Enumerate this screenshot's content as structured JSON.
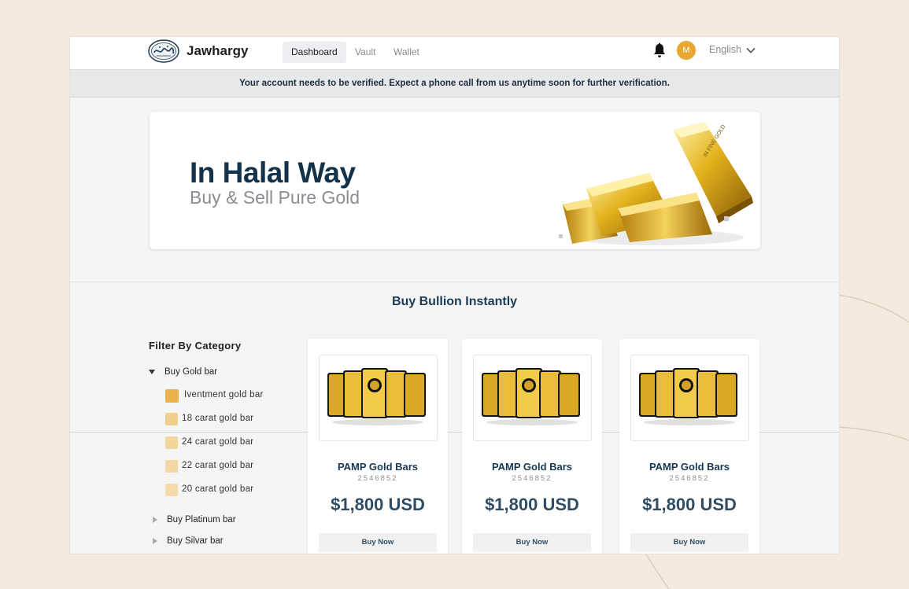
{
  "header": {
    "brand": "Jawhargy",
    "tabs": [
      {
        "label": "Dashboard",
        "active": true
      },
      {
        "label": "Vault",
        "active": false
      },
      {
        "label": "Wallet",
        "active": false
      }
    ],
    "icons": {
      "notifications": "bell-icon",
      "language_toggle": "chevron-down-icon"
    },
    "avatar_initial": "M",
    "language": "English"
  },
  "notice": "Your account needs to be verified. Expect a phone call from us anytime soon for further verification.",
  "hero": {
    "title": "In Halal Way",
    "subtitle": "Buy & Sell Pure Gold"
  },
  "section_title": "Buy Bullion Instantly",
  "filter": {
    "title": "Filter By Category",
    "categories": [
      {
        "label": "Buy Gold bar",
        "expanded": true,
        "subcategories": [
          {
            "label": "Iventment gold bar",
            "color": "#e8b34b"
          },
          {
            "label": "18 carat gold bar",
            "color": "#f0cf8c"
          },
          {
            "label": "24 carat gold bar",
            "color": "#f2d69b"
          },
          {
            "label": "22 carat gold bar",
            "color": "#f2d9a3"
          },
          {
            "label": "20 carat gold bar",
            "color": "#f3dbaa"
          }
        ]
      },
      {
        "label": "Buy Platinum bar",
        "expanded": false
      },
      {
        "label": "Buy Silvar bar",
        "expanded": false
      }
    ]
  },
  "products": [
    {
      "name": "PAMP Gold Bars",
      "sku": "2546852",
      "price": "$1,800 USD",
      "button": "Buy Now"
    },
    {
      "name": "PAMP Gold Bars",
      "sku": "2546852",
      "price": "$1,800 USD",
      "button": "Buy Now"
    },
    {
      "name": "PAMP Gold Bars",
      "sku": "2546852",
      "price": "$1,800 USD",
      "button": "Buy Now"
    }
  ],
  "colors": {
    "accent_navy": "#13334d",
    "gold": "#e8a632",
    "page_background": "#f3ebdf"
  }
}
